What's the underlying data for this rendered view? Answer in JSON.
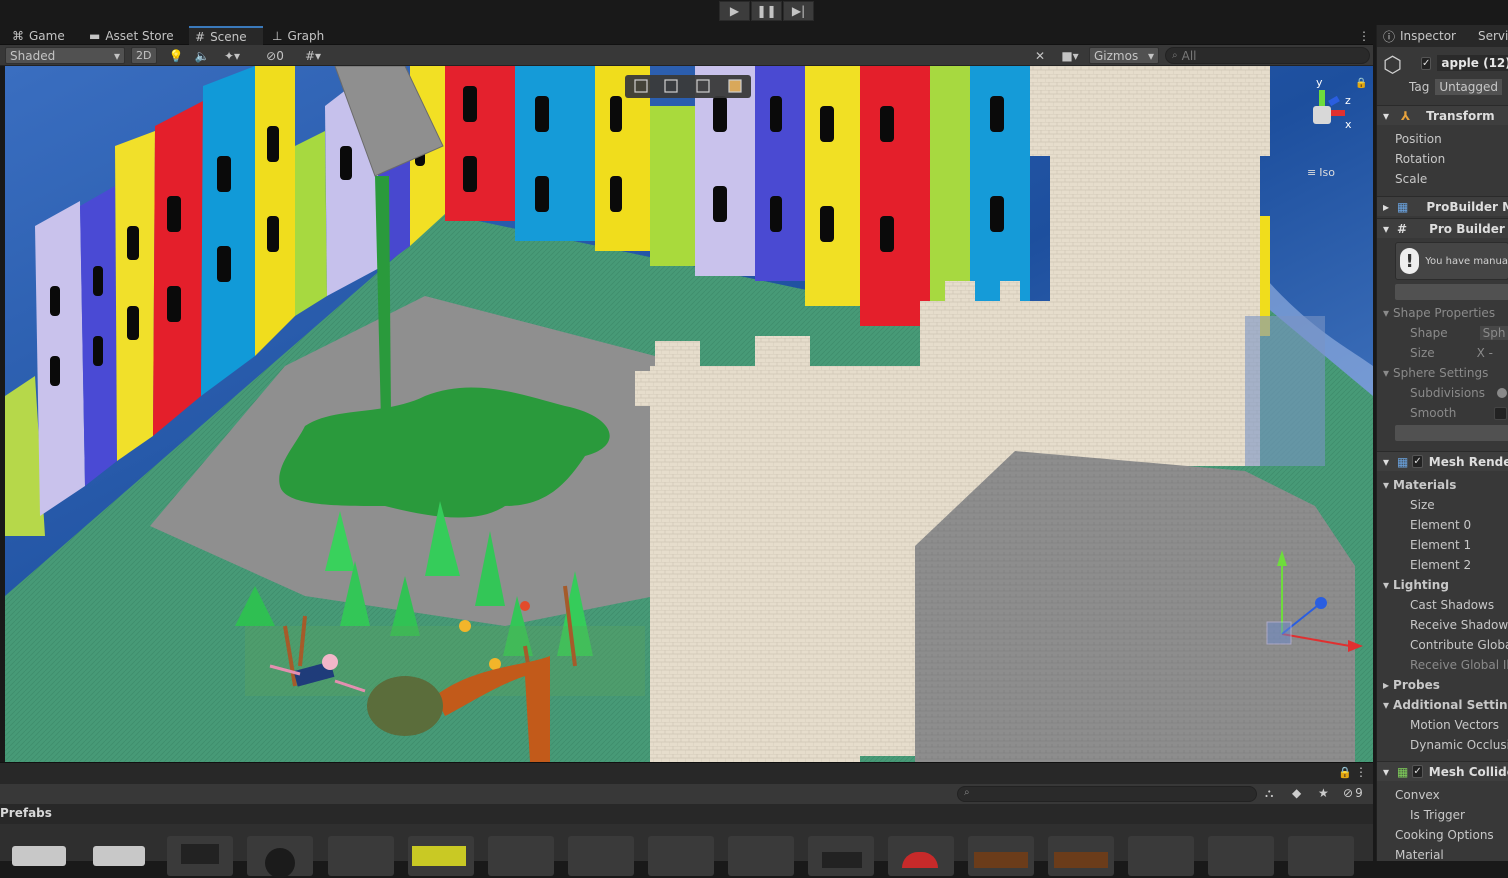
{
  "toolbar": {
    "play_icon": "play-icon",
    "pause_icon": "pause-icon",
    "step_icon": "step-icon"
  },
  "tabs": {
    "game": {
      "label": "Game",
      "icon": "gamepad-icon"
    },
    "asset_store": {
      "label": "Asset Store",
      "icon": "bag-icon"
    },
    "scene": {
      "label": "Scene",
      "icon": "hash-icon"
    },
    "graph": {
      "label": "Graph",
      "icon": "graph-icon"
    }
  },
  "scene_toolbar": {
    "shading_mode": "Shaded",
    "mode_2d": "2D",
    "hidden_count": "0",
    "gizmos": "Gizmos",
    "search_placeholder": "All"
  },
  "scene_gizmo": {
    "y": "y",
    "x": "x",
    "z": "z",
    "projection": "Iso"
  },
  "inspector": {
    "tab": "Inspector",
    "tab2": "Servic",
    "object_name": "apple (12)",
    "tag_label": "Tag",
    "tag_value": "Untagged",
    "transform": {
      "title": "Transform",
      "position": "Position",
      "rotation": "Rotation",
      "scale": "Scale"
    },
    "probuilder_m": "ProBuilder M",
    "probuilder_s": "Pro Builder S",
    "warning": "You have manua",
    "shape_properties": "Shape Properties",
    "shape": "Shape",
    "shape_value": "Sph",
    "size": "Size",
    "size_value": "X  -",
    "sphere_settings": "Sphere Settings",
    "subdivisions": "Subdivisions",
    "smooth": "Smooth",
    "mesh_renderer": "Mesh Rende",
    "materials": "Materials",
    "mat_size": "Size",
    "element0": "Element 0",
    "element1": "Element 1",
    "element2": "Element 2",
    "lighting": "Lighting",
    "cast_shadows": "Cast Shadows",
    "receive_shadows": "Receive Shadows",
    "contribute_global": "Contribute Global",
    "receive_global": "Receive Global Illu",
    "probes": "Probes",
    "additional_settings": "Additional Settings",
    "motion_vectors": "Motion Vectors",
    "dynamic_occlusion": "Dynamic Occlusio",
    "mesh_collider": "Mesh Collide",
    "convex": "Convex",
    "is_trigger": "Is Trigger",
    "cooking_options": "Cooking Options",
    "material": "Material"
  },
  "project": {
    "header": "Prefabs",
    "hidden_count": "9"
  }
}
